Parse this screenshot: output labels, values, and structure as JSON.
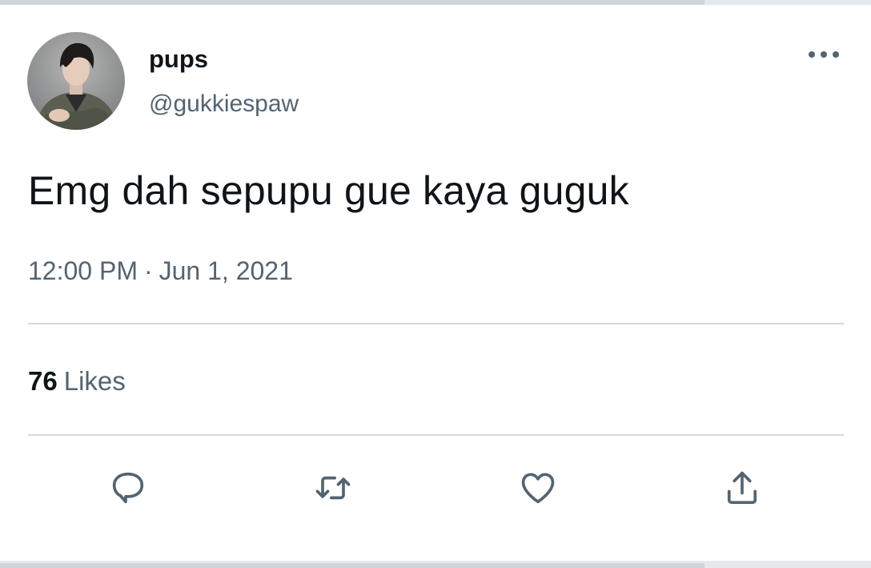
{
  "tweet": {
    "display_name": "pups",
    "handle": "@gukkiespaw",
    "text": "Emg dah sepupu gue kaya guguk",
    "time": "12:00 PM",
    "separator": "·",
    "date": "Jun 1, 2021"
  },
  "stats": {
    "likes_count": "76",
    "likes_label": "Likes"
  },
  "icons": {
    "more": "more-dots-icon",
    "reply": "reply-bubble-icon",
    "retweet": "retweet-icon",
    "like": "heart-icon",
    "share": "share-upload-icon"
  },
  "colors": {
    "text_primary": "#0f1419",
    "text_secondary": "#536471",
    "divider": "#d3d9de",
    "icon": "#536471"
  }
}
